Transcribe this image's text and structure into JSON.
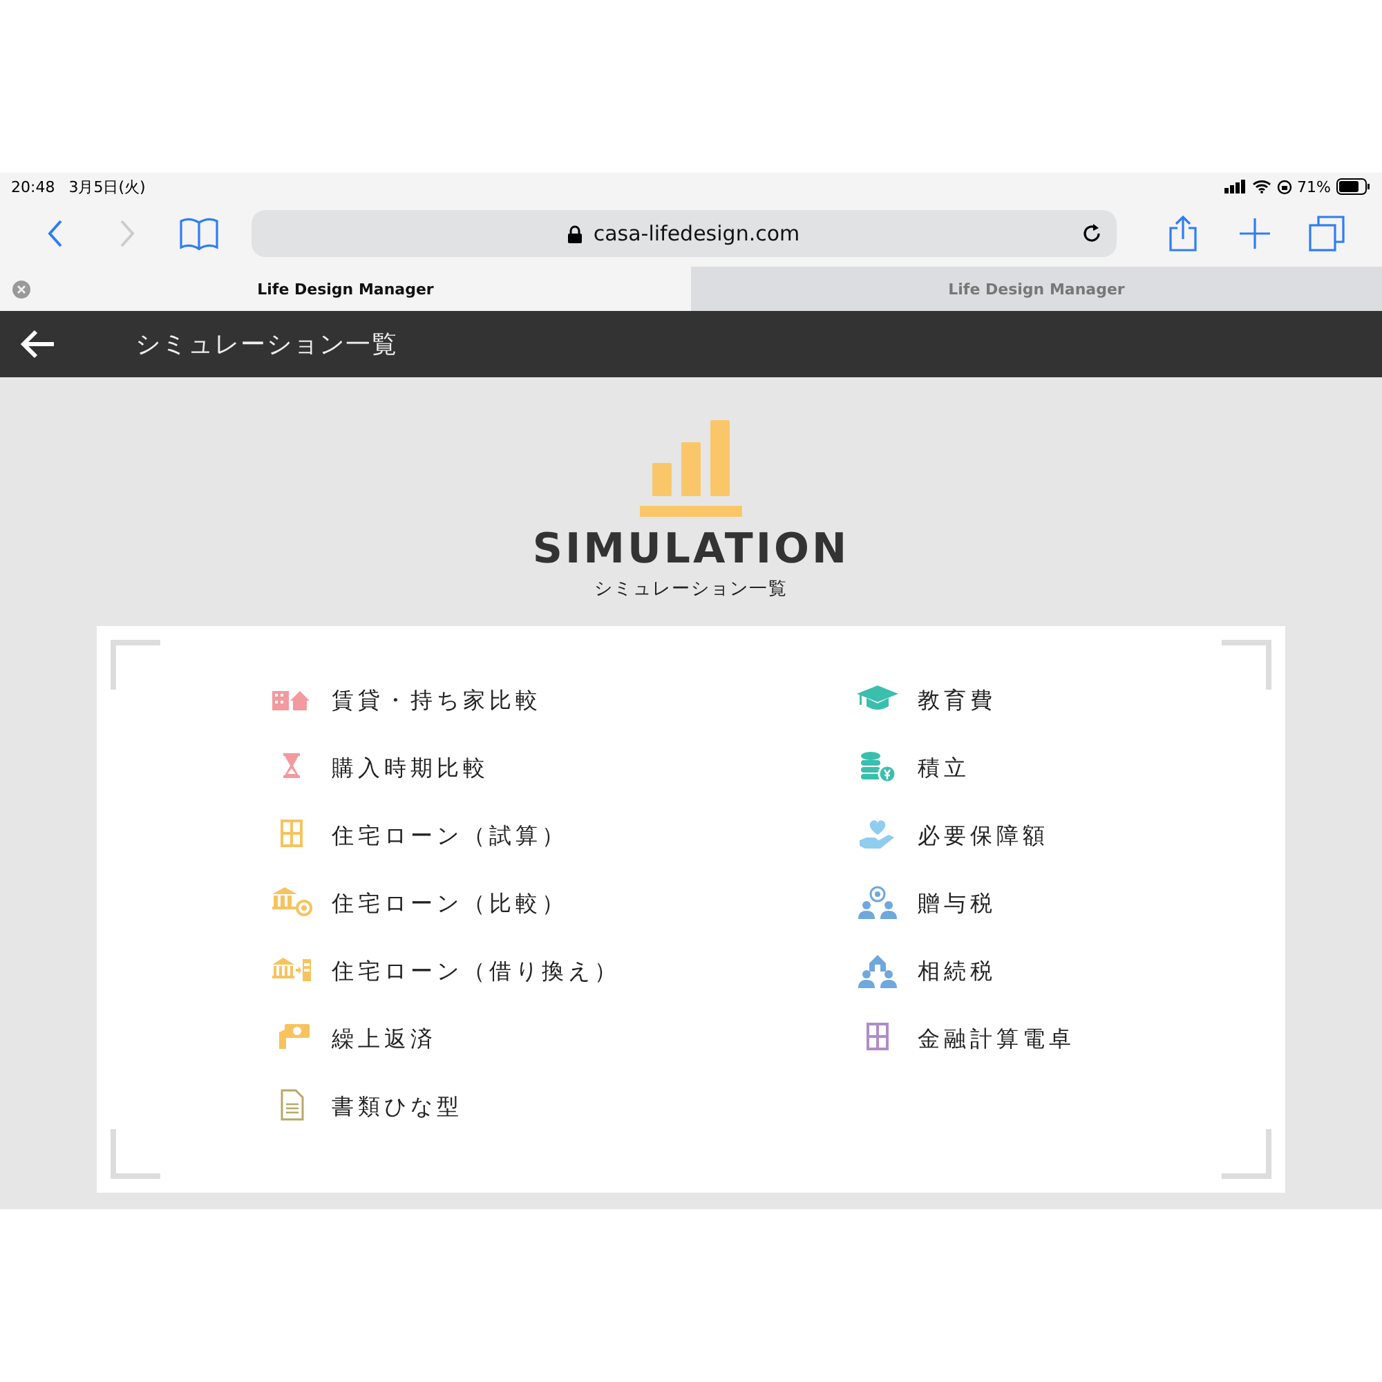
{
  "status_bar": {
    "time": "20:48",
    "date": "3月5日(火)",
    "battery": "71%"
  },
  "address_bar": {
    "url": "casa-lifedesign.com"
  },
  "tabs": [
    {
      "label": "Life Design Manager",
      "selected": true
    },
    {
      "label": "Life Design Manager",
      "selected": false
    }
  ],
  "header": {
    "title": "シミュレーション一覧"
  },
  "hero": {
    "title": "SIMULATION",
    "subtitle": "シミュレーション一覧"
  },
  "columns": [
    [
      {
        "label": "賃貸・持ち家比較",
        "kind": "building-house",
        "color": "#f29a9f"
      },
      {
        "label": "購入時期比較",
        "kind": "hourglass",
        "color": "#f29a9f"
      },
      {
        "label": "住宅ローン（試算）",
        "kind": "calculator",
        "color": "#f7c35f"
      },
      {
        "label": "住宅ローン（比較）",
        "kind": "bank-coin",
        "color": "#f7c35f"
      },
      {
        "label": "住宅ローン（借り換え）",
        "kind": "bank-transfer",
        "color": "#f7c35f"
      },
      {
        "label": "繰上返済",
        "kind": "hand-money",
        "color": "#f7c35f"
      },
      {
        "label": "書類ひな型",
        "kind": "document",
        "color": "#b8a76a"
      }
    ],
    [
      {
        "label": "教育費",
        "kind": "cap",
        "color": "#3bbfad"
      },
      {
        "label": "積立",
        "kind": "coins",
        "color": "#3bbfad"
      },
      {
        "label": "必要保障額",
        "kind": "heart-hand",
        "color": "#8fcdef"
      },
      {
        "label": "贈与税",
        "kind": "people-coin",
        "color": "#6fa8dc"
      },
      {
        "label": "相続税",
        "kind": "people-house",
        "color": "#6fa8dc"
      },
      {
        "label": "金融計算電卓",
        "kind": "calculator",
        "color": "#b08cc8"
      }
    ]
  ]
}
